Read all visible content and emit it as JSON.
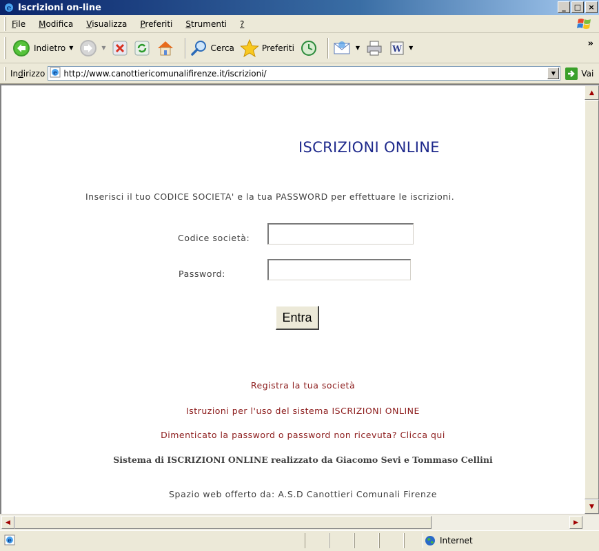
{
  "window": {
    "title": "Iscrizioni on-line",
    "min_glyph": "_",
    "max_glyph": "□",
    "close_glyph": "×"
  },
  "menubar": {
    "items": [
      {
        "first": "F",
        "rest": "ile"
      },
      {
        "first": "M",
        "rest": "odifica"
      },
      {
        "first": "V",
        "rest": "isualizza"
      },
      {
        "first": "P",
        "rest": "referiti"
      },
      {
        "first": "S",
        "rest": "trumenti"
      },
      {
        "first": "?",
        "rest": ""
      }
    ]
  },
  "toolbar": {
    "back_label": "Indietro",
    "search_label": "Cerca",
    "favorites_label": "Preferiti",
    "chevron": "»"
  },
  "addressbar": {
    "label_pre": "In",
    "label_acc": "d",
    "label_post": "irizzo",
    "url": "http://www.canottiericomunalifirenze.it/iscrizioni/",
    "go_label": "Vai"
  },
  "page": {
    "heading": "ISCRIZIONI ONLINE",
    "instructions": "Inserisci il tuo CODICE SOCIETA' e la tua PASSWORD per effettuare le iscrizioni.",
    "codice_label": "Codice società:",
    "codice_value": "",
    "password_label": "Password:",
    "password_value": "",
    "submit_label": "Entra",
    "link_register": "Registra la tua società",
    "link_instructions": "Istruzioni per l'uso del sistema ISCRIZIONI ONLINE",
    "link_forgot": "Dimenticato la password o password non ricevuta? Clicca qui",
    "credit": "Sistema di ISCRIZIONI ONLINE realizzato da Giacomo Sevi e Tommaso Cellini",
    "footer": "Spazio web offerto da: A.S.D Canottieri Comunali Firenze"
  },
  "statusbar": {
    "zone": "Internet"
  },
  "colors": {
    "heading": "#1f2a8c",
    "link": "#8b1a1a",
    "text": "#404040",
    "chrome": "#ece9d8"
  },
  "icons": [
    "ie-icon",
    "windows-logo-icon",
    "back-icon",
    "forward-icon",
    "stop-icon",
    "refresh-icon",
    "home-icon",
    "search-icon",
    "favorites-icon",
    "history-icon",
    "mail-icon",
    "print-icon",
    "word-icon",
    "go-icon",
    "globe-icon"
  ]
}
